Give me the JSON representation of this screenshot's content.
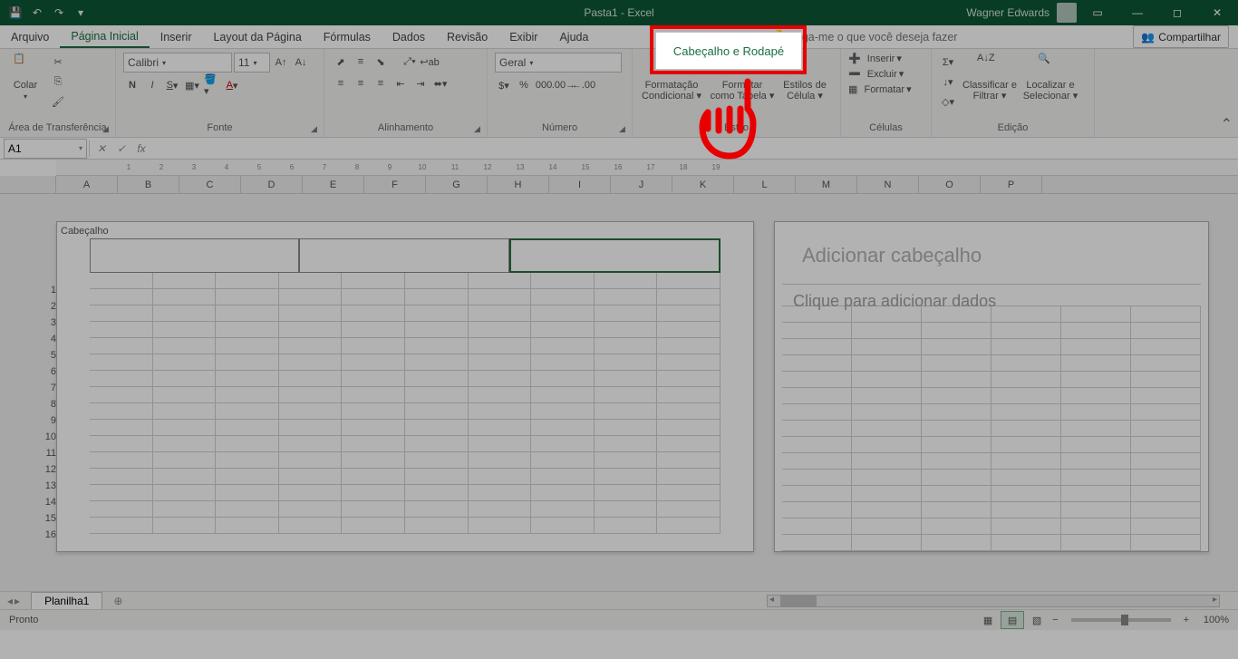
{
  "titlebar": {
    "title": "Pasta1 - Excel",
    "user": "Wagner Edwards"
  },
  "tabs": {
    "file": "Arquivo",
    "home": "Página Inicial",
    "insert": "Inserir",
    "layout": "Layout da Página",
    "formulas": "Fórmulas",
    "data": "Dados",
    "review": "Revisão",
    "view": "Exibir",
    "help": "Ajuda",
    "contextual": "Cabeçalho e Rodapé",
    "tellme": "Diga-me o que você deseja fazer",
    "share": "Compartilhar"
  },
  "ribbon": {
    "clipboard": {
      "label": "Área de Transferência",
      "paste": "Colar"
    },
    "font": {
      "label": "Fonte",
      "name": "Calibri",
      "size": "11"
    },
    "alignment": {
      "label": "Alinhamento"
    },
    "number": {
      "label": "Número",
      "format": "Geral"
    },
    "styles": {
      "label": "Estilo",
      "condfmt": "Formatação Condicional",
      "table": "Formatar como Tabela",
      "cellstyles": "Estilos de Célula"
    },
    "cells": {
      "label": "Células",
      "insert": "Inserir",
      "delete": "Excluir",
      "format": "Formatar"
    },
    "editing": {
      "label": "Edição",
      "sort": "Classificar e Filtrar",
      "find": "Localizar e Selecionar"
    }
  },
  "formula_bar": {
    "cell_ref": "A1"
  },
  "columns": [
    "A",
    "B",
    "C",
    "D",
    "E",
    "F",
    "G",
    "H",
    "I",
    "J",
    "K",
    "L",
    "M",
    "N",
    "O",
    "P"
  ],
  "rows": [
    1,
    2,
    3,
    4,
    5,
    6,
    7,
    8,
    9,
    10,
    11,
    12,
    13,
    14,
    15,
    16
  ],
  "page_layout": {
    "header_label": "Cabeçalho",
    "add_header": "Adicionar cabeçalho",
    "add_data": "Clique para adicionar dados"
  },
  "sheet_tabs": {
    "sheet1": "Planilha1"
  },
  "status": {
    "ready": "Pronto",
    "zoom": "100%"
  },
  "ruler_marks": [
    1,
    2,
    3,
    4,
    5,
    6,
    7,
    8,
    9,
    10,
    11,
    12,
    13,
    14,
    15,
    16,
    17,
    18,
    19
  ]
}
